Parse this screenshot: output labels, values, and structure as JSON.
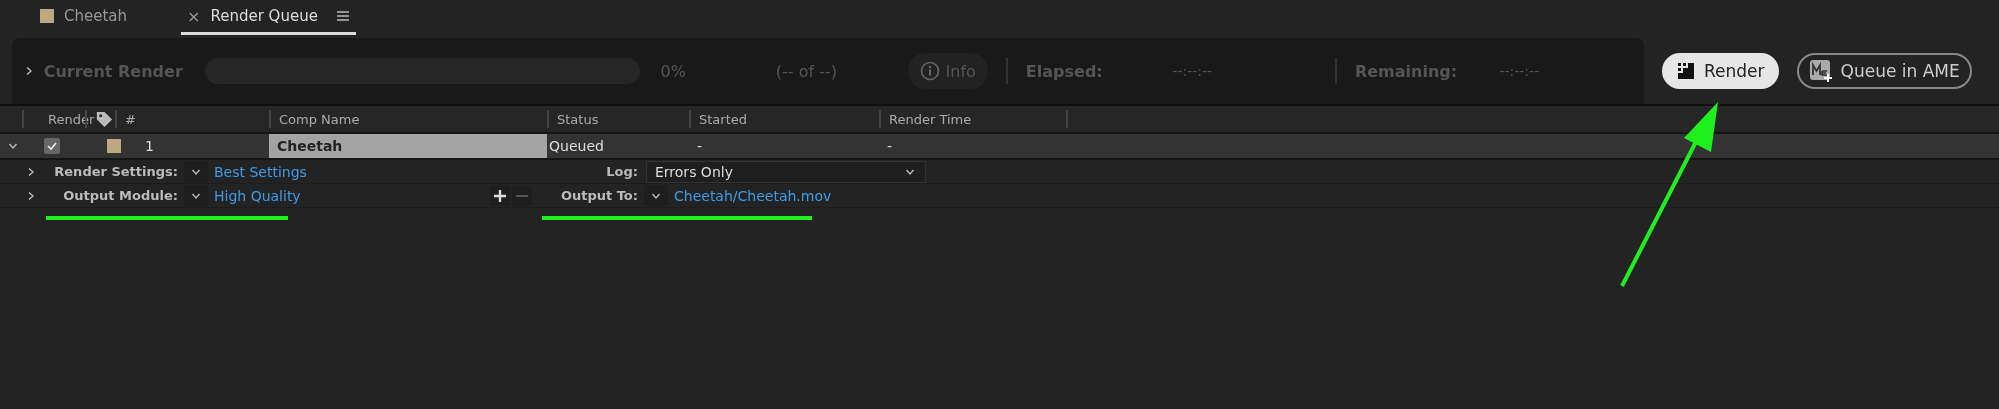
{
  "tabs": [
    {
      "label": "Cheetah",
      "kind": "comp",
      "selected": false
    },
    {
      "label": "Render Queue",
      "kind": "panel",
      "selected": true,
      "close": "×"
    }
  ],
  "current_render": {
    "title": "Current Render",
    "level": 0,
    "percent": "0%",
    "count": "(-- of --)",
    "info": "Info",
    "elapsed_label": "Elapsed:",
    "elapsed": "--:--:--",
    "remaining_label": "Remaining:",
    "remaining": "--:--:--"
  },
  "buttons": [
    {
      "label": "Render",
      "kind": "render"
    },
    {
      "label": "Queue in AME",
      "kind": "ame"
    }
  ],
  "table": {
    "columns": [
      "Render",
      "",
      "#",
      "Comp Name",
      "Status",
      "Started",
      "Render Time"
    ],
    "rows": [
      {
        "expanded": true,
        "checked": true,
        "number": "1",
        "comp_name": "Cheetah",
        "status": "Queued",
        "started": "-",
        "render_time": "-",
        "render_settings": {
          "label": "Render Settings:",
          "value": "Best Settings",
          "expanded": false
        },
        "log": {
          "label": "Log:",
          "value": "Errors Only"
        },
        "output_module": {
          "label": "Output Module:",
          "value": "High Quality",
          "expanded": false
        },
        "output_to": {
          "label": "Output To:",
          "value": "Cheetah/Cheetah.mov"
        }
      }
    ]
  }
}
